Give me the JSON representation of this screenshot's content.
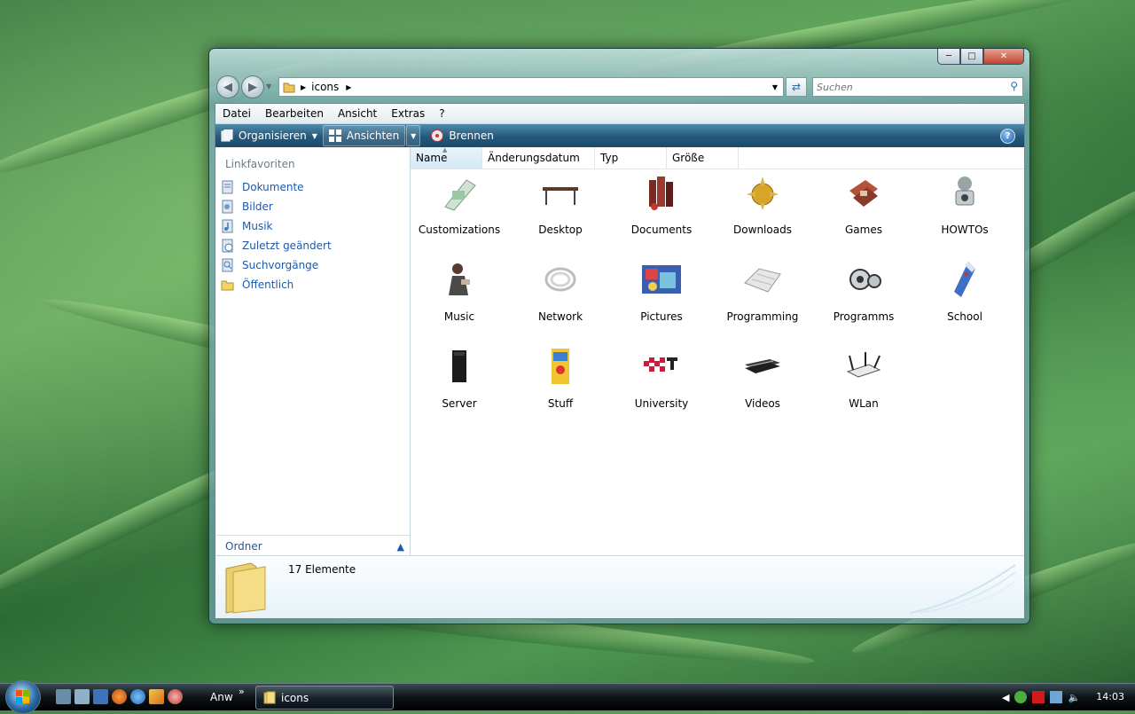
{
  "window": {
    "caption_buttons": [
      "minimize",
      "maximize",
      "close"
    ],
    "address": {
      "path": "icons",
      "search_placeholder": "Suchen"
    },
    "menu": [
      "Datei",
      "Bearbeiten",
      "Ansicht",
      "Extras",
      "?"
    ],
    "toolbar": {
      "organize": "Organisieren",
      "views": "Ansichten",
      "burn": "Brennen"
    },
    "nav": {
      "header": "Linkfavoriten",
      "items": [
        "Dokumente",
        "Bilder",
        "Musik",
        "Zuletzt geändert",
        "Suchvorgänge",
        "Öffentlich"
      ],
      "folders": "Ordner"
    },
    "columns": [
      "Name",
      "Änderungsdatum",
      "Typ",
      "Größe"
    ],
    "items": [
      "Customizations",
      "Desktop",
      "Documents",
      "Downloads",
      "Games",
      "HOWTOs",
      "Music",
      "Network",
      "Pictures",
      "Programming",
      "Programms",
      "School",
      "Server",
      "Stuff",
      "University",
      "Videos",
      "WLan"
    ],
    "status": {
      "count": "17 Elemente"
    }
  },
  "taskbar": {
    "quicklaunch_label": "Anw",
    "task": "icons",
    "clock": "14:03"
  },
  "colors": {
    "link": "#1e59a8",
    "toolbar": "#24587a"
  }
}
